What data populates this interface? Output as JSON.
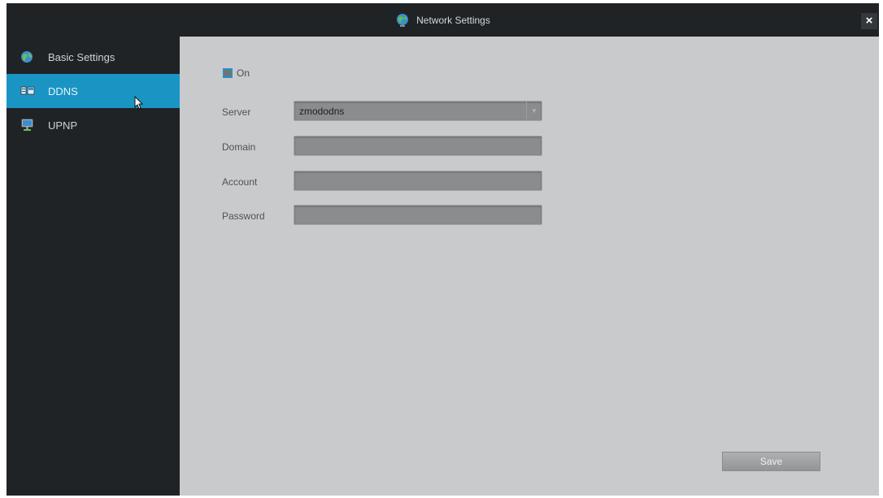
{
  "window": {
    "title": "Network Settings",
    "title_icon": "globe-icon",
    "close_label": "×"
  },
  "sidebar": {
    "items": [
      {
        "label": "Basic Settings",
        "icon": "network-icon",
        "active": false
      },
      {
        "label": "DDNS",
        "icon": "ddns-icon",
        "active": true
      },
      {
        "label": "UPNP",
        "icon": "monitor-icon",
        "active": false
      }
    ]
  },
  "form": {
    "enable_label": "On",
    "enabled": false,
    "server_label": "Server",
    "server_value": "zmododns",
    "domain_label": "Domain",
    "domain_value": "",
    "account_label": "Account",
    "account_value": "",
    "password_label": "Password",
    "password_value": "",
    "save_label": "Save"
  },
  "colors": {
    "sidebar_bg": "#1f2326",
    "active_item": "#1a95c3",
    "content_bg": "#c9cacc",
    "field_bg": "#8a8c8e"
  }
}
